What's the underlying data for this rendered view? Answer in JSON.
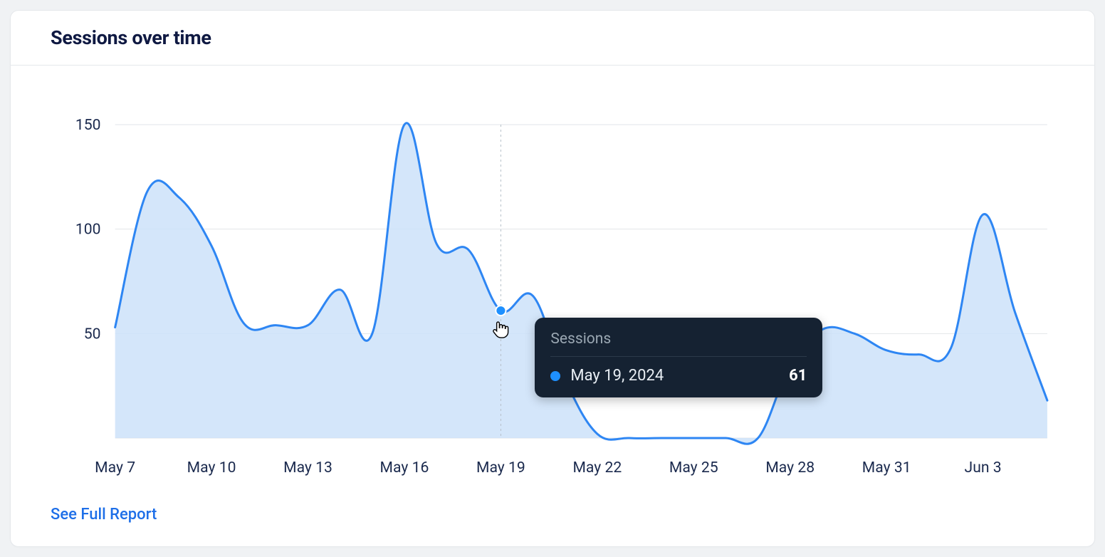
{
  "header": {
    "title": "Sessions over time"
  },
  "link": {
    "label": "See Full Report"
  },
  "tooltip": {
    "title": "Sessions",
    "date": "May 19, 2024",
    "value": "61"
  },
  "axes": {
    "y": [
      "50",
      "100",
      "150"
    ],
    "x": [
      "May 7",
      "May 10",
      "May 13",
      "May 16",
      "May 19",
      "May 22",
      "May 25",
      "May 28",
      "May 31",
      "Jun 3"
    ]
  },
  "chart_data": {
    "type": "area",
    "title": "Sessions over time",
    "xlabel": "",
    "ylabel": "",
    "ylim": [
      0,
      150
    ],
    "x": [
      "May 7",
      "May 8",
      "May 9",
      "May 10",
      "May 11",
      "May 12",
      "May 13",
      "May 14",
      "May 15",
      "May 16",
      "May 17",
      "May 18",
      "May 19",
      "May 20",
      "May 21",
      "May 22",
      "May 23",
      "May 24",
      "May 25",
      "May 26",
      "May 27",
      "May 28",
      "May 29",
      "May 30",
      "May 31",
      "Jun 1",
      "Jun 2",
      "Jun 3",
      "Jun 4",
      "Jun 5"
    ],
    "series": [
      {
        "name": "Sessions",
        "values": [
          53,
          118,
          115,
          92,
          55,
          54,
          54,
          71,
          50,
          150,
          93,
          90,
          61,
          68,
          28,
          2,
          0,
          0,
          0,
          0,
          0,
          35,
          52,
          50,
          42,
          40,
          43,
          107,
          60,
          18
        ]
      }
    ],
    "hover": {
      "index": 12,
      "date": "May 19, 2024",
      "value": 61
    }
  }
}
